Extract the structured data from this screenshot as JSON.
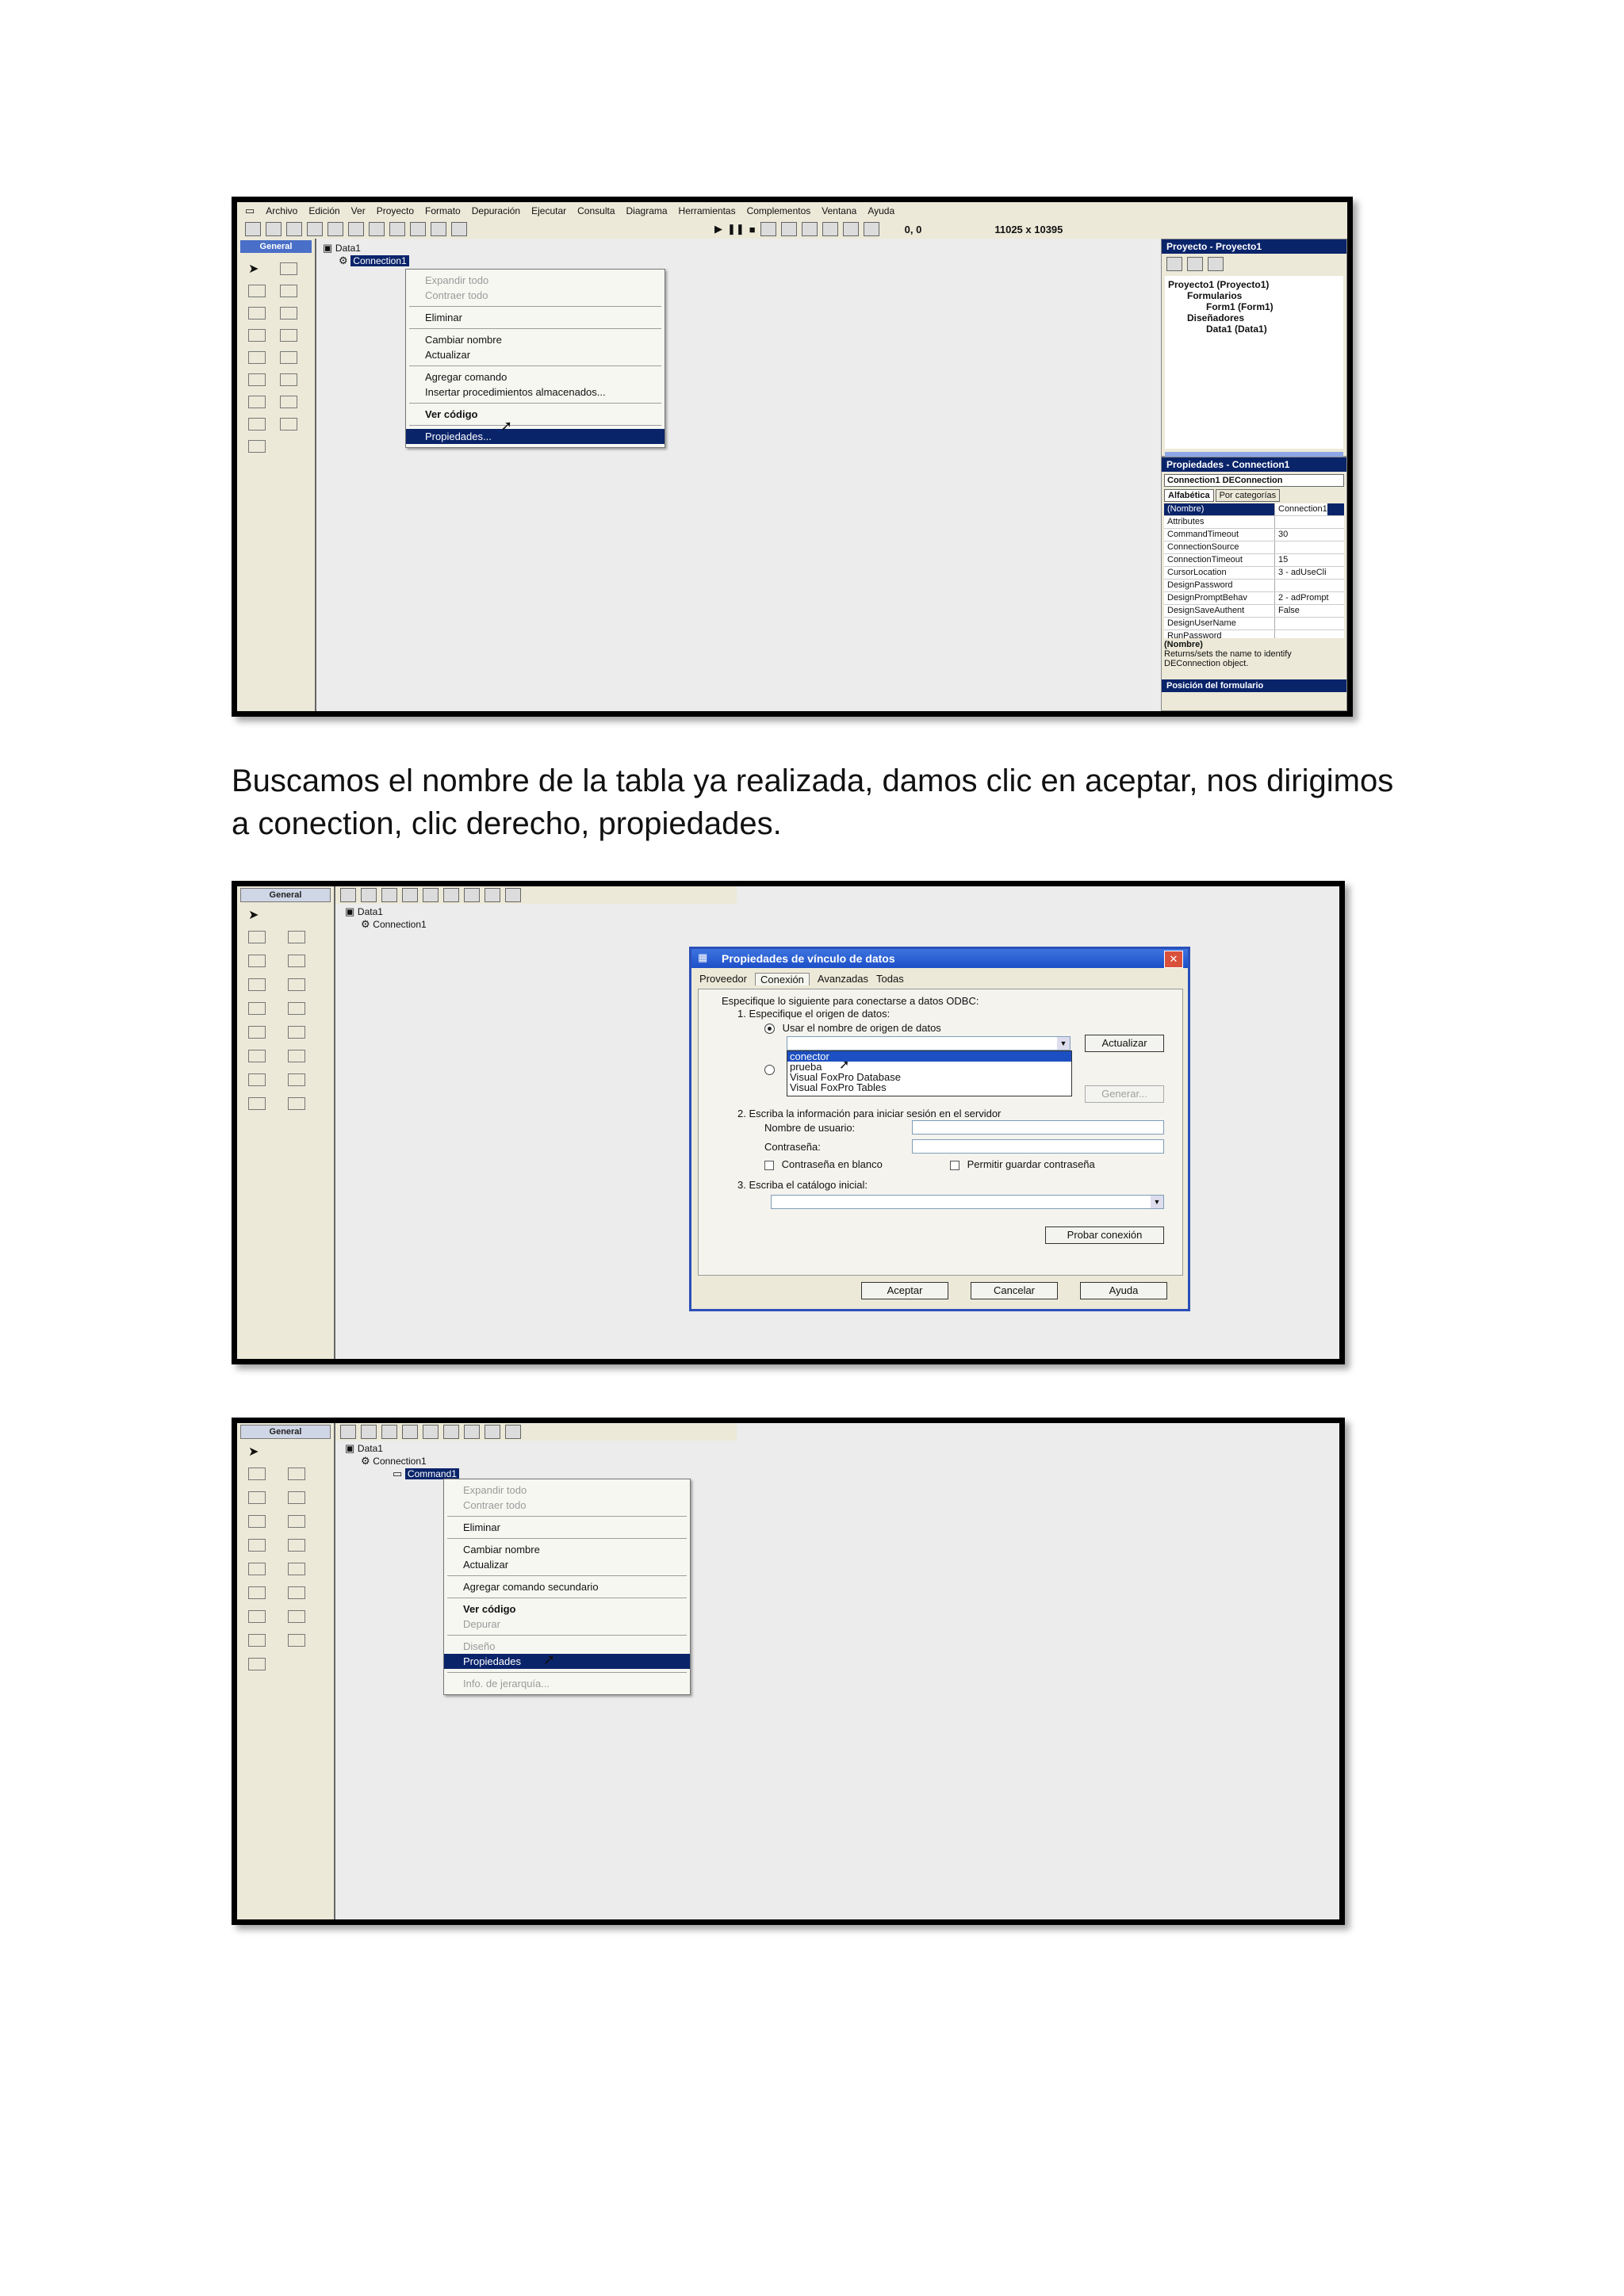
{
  "caption": "Buscamos el nombre de la tabla ya realizada, damos clic en aceptar, nos dirigimos a conection, clic derecho, propiedades.",
  "shot1": {
    "menu": [
      "Archivo",
      "Edición",
      "Ver",
      "Proyecto",
      "Formato",
      "Depuración",
      "Ejecutar",
      "Consulta",
      "Diagrama",
      "Herramientas",
      "Complementos",
      "Ventana",
      "Ayuda"
    ],
    "coords": "0, 0",
    "size": "11025 x 10395",
    "toolbox_title": "General",
    "tree_root": "Data1",
    "tree_child": "Connection1",
    "context_menu": [
      {
        "label": "Expandir todo",
        "state": "dis"
      },
      {
        "label": "Contraer todo",
        "state": "dis"
      },
      {
        "sep": true
      },
      {
        "label": "Eliminar",
        "state": ""
      },
      {
        "sep": true
      },
      {
        "label": "Cambiar nombre",
        "state": ""
      },
      {
        "label": "Actualizar",
        "state": ""
      },
      {
        "sep": true
      },
      {
        "label": "Agregar comando",
        "state": ""
      },
      {
        "label": "Insertar procedimientos almacenados...",
        "state": ""
      },
      {
        "sep": true
      },
      {
        "label": "Ver código",
        "state": "bold"
      },
      {
        "sep": true
      },
      {
        "label": "Propiedades...",
        "state": "sel"
      }
    ],
    "project_title": "Proyecto - Proyecto1",
    "project_tree": [
      "Proyecto1 (Proyecto1)",
      "Formularios",
      "Form1 (Form1)",
      "Diseñadores",
      "Data1 (Data1)"
    ],
    "props_title": "Propiedades - Connection1",
    "props_object": "Connection1 DEConnection",
    "props_tabs": [
      "Alfabética",
      "Por categorías"
    ],
    "props_rows": [
      {
        "k": "(Nombre)",
        "v": "Connection1"
      },
      {
        "k": "Attributes",
        "v": ""
      },
      {
        "k": "CommandTimeout",
        "v": "30"
      },
      {
        "k": "ConnectionSource",
        "v": ""
      },
      {
        "k": "ConnectionTimeout",
        "v": "15"
      },
      {
        "k": "CursorLocation",
        "v": "3 - adUseCli"
      },
      {
        "k": "DesignPassword",
        "v": ""
      },
      {
        "k": "DesignPromptBehav",
        "v": "2 - adPrompt"
      },
      {
        "k": "DesignSaveAuthent",
        "v": "False"
      },
      {
        "k": "DesignUserName",
        "v": ""
      },
      {
        "k": "RunPassword",
        "v": ""
      }
    ],
    "props_desc_title": "(Nombre)",
    "props_desc": "Returns/sets the name to identify DEConnection object.",
    "form_pos_title": "Posición del formulario"
  },
  "shot2": {
    "toolbox_title": "General",
    "tree_root": "Data1",
    "tree_child": "Connection1",
    "dialog_title": "Propiedades de vínculo de datos",
    "tabs": [
      "Proveedor",
      "Conexión",
      "Avanzadas",
      "Todas"
    ],
    "intro": "Especifique lo siguiente para conectarse a datos ODBC:",
    "step1": "1. Especifique el origen de datos:",
    "radio1": "Usar el nombre de origen de datos",
    "refresh": "Actualizar",
    "dropdown": [
      "conector",
      "prueba",
      "Visual FoxPro Database",
      "Visual FoxPro Tables"
    ],
    "build": "Generar...",
    "step2": "2. Escriba la información para iniciar sesión en el servidor",
    "user_label": "Nombre de usuario:",
    "pass_label": "Contraseña:",
    "blank_pass": "Contraseña en blanco",
    "save_pass": "Permitir guardar contraseña",
    "step3": "3. Escriba el catálogo inicial:",
    "test": "Probar conexión",
    "ok": "Aceptar",
    "cancel": "Cancelar",
    "help": "Ayuda"
  },
  "shot3": {
    "toolbox_title": "General",
    "tree_root": "Data1",
    "tree_child": "Connection1",
    "tree_cmd": "Command1",
    "context_menu": [
      {
        "label": "Expandir todo",
        "state": "dis"
      },
      {
        "label": "Contraer todo",
        "state": "dis"
      },
      {
        "sep": true
      },
      {
        "label": "Eliminar",
        "state": ""
      },
      {
        "sep": true
      },
      {
        "label": "Cambiar nombre",
        "state": ""
      },
      {
        "label": "Actualizar",
        "state": ""
      },
      {
        "sep": true
      },
      {
        "label": "Agregar comando secundario",
        "state": ""
      },
      {
        "sep": true
      },
      {
        "label": "Ver código",
        "state": "bold"
      },
      {
        "label": "Depurar",
        "state": "dis"
      },
      {
        "sep": true
      },
      {
        "label": "Diseño",
        "state": "dis"
      },
      {
        "label": "Propiedades",
        "state": "sel"
      },
      {
        "sep": true
      },
      {
        "label": "Info. de jerarquía...",
        "state": "dis"
      }
    ]
  }
}
